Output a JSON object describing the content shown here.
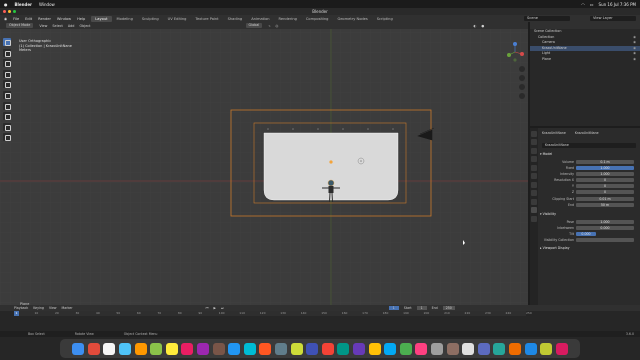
{
  "macbar": {
    "app": "Blender",
    "menu": "Window",
    "datetime": "Sun 16 Jul  7:36 PM"
  },
  "window_title": "Blender",
  "blender_menu": [
    "File",
    "Edit",
    "Render",
    "Window",
    "Help"
  ],
  "workspace_tabs": [
    "Layout",
    "Modeling",
    "Sculpting",
    "UV Editing",
    "Texture Paint",
    "Shading",
    "Animation",
    "Rendering",
    "Compositing",
    "Geometry Nodes",
    "Scripting"
  ],
  "active_tab": "Layout",
  "scene_name": "Scene",
  "view_layer": "View Layer",
  "viewport": {
    "mode": "Object Mode",
    "menus": [
      "View",
      "Select",
      "Add",
      "Object"
    ],
    "orientation": "Global",
    "info_line1": "User Orthographic",
    "info_line2": "(1) Collection | KrazoUnitNane",
    "info_line3": "Meters",
    "bottom_label": "Plane"
  },
  "outliner": {
    "rows": [
      {
        "label": "Scene Collection",
        "indent": 0,
        "selected": false
      },
      {
        "label": "Collection",
        "indent": 1,
        "selected": false
      },
      {
        "label": "Camera",
        "indent": 2,
        "selected": false
      },
      {
        "label": "KrazoUnitNane",
        "indent": 2,
        "selected": true
      },
      {
        "label": "Light",
        "indent": 2,
        "selected": false
      },
      {
        "label": "Plane",
        "indent": 2,
        "selected": false
      }
    ]
  },
  "properties": {
    "object_name": "KrazoUnitNane",
    "data_name": "KrazoUnitNane",
    "section_1": "Model",
    "fields": [
      {
        "label": "Volume",
        "value": "0.1 m",
        "blue": false
      },
      {
        "label": "Fixed",
        "value": "1.000",
        "blue": true
      },
      {
        "label": "Intensity",
        "value": "1.000",
        "blue": false
      },
      {
        "label": "Resolution X",
        "value": "0",
        "blue": false
      },
      {
        "label": "Y",
        "value": "0",
        "blue": false
      },
      {
        "label": "Z",
        "value": "0",
        "blue": false
      },
      {
        "label": "Clipping Start",
        "value": "0.01 m",
        "blue": false
      },
      {
        "label": "End",
        "value": "50 m",
        "blue": false
      }
    ],
    "section_2": "Visibility",
    "fields2": [
      {
        "label": "Pose",
        "value": "1.000",
        "blue": false
      },
      {
        "label": "Inbetween",
        "value": "0.000",
        "blue": false
      },
      {
        "label": "Tilt",
        "value": "0.000",
        "blue": true
      }
    ],
    "collection_label": "Visibility Collection",
    "section_3": "Viewport Display"
  },
  "timeline": {
    "menus": [
      "Playback",
      "Keying",
      "View",
      "Marker"
    ],
    "frame_current": "1",
    "start_label": "Start",
    "start": "1",
    "end_label": "End",
    "end": "250",
    "ticks": [
      "0",
      "10",
      "20",
      "30",
      "40",
      "50",
      "60",
      "70",
      "80",
      "90",
      "100",
      "110",
      "120",
      "130",
      "140",
      "150",
      "160",
      "170",
      "180",
      "190",
      "200",
      "210",
      "220",
      "230",
      "240",
      "250"
    ]
  },
  "statusbar": [
    "Box Select",
    "Rotate View",
    "Object Context Menu"
  ],
  "version": "3.6.0",
  "colors": {
    "accent": "#4772b3",
    "selection": "#f4a43a",
    "viewport_bg": "#3c3c3c"
  }
}
